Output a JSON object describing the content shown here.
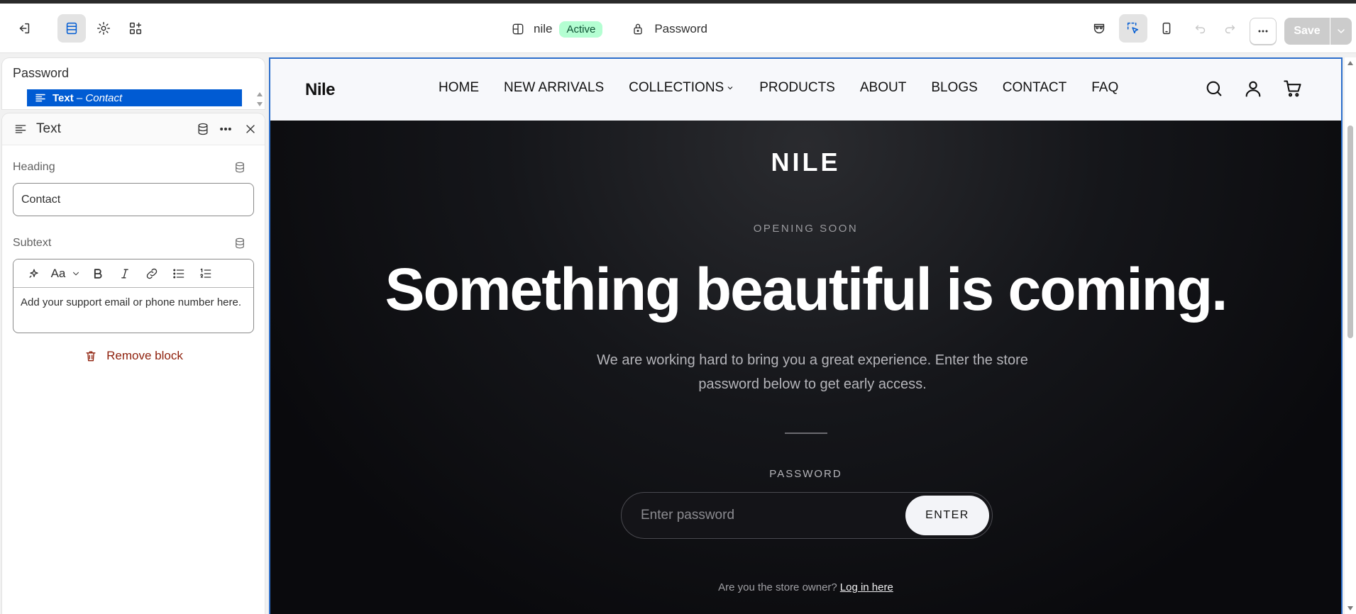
{
  "topbar": {
    "theme_name": "nile",
    "status_badge": "Active",
    "page_template": "Password",
    "save_label": "Save"
  },
  "sidebar": {
    "section_title": "Password",
    "tree_item_type": "Text",
    "tree_item_separator": " – ",
    "tree_item_name": "Contact",
    "block_title": "Text",
    "heading_label": "Heading",
    "heading_value": "Contact",
    "subtext_label": "Subtext",
    "subtext_value": "Add your support email or phone number here.",
    "remove_label": "Remove block"
  },
  "store": {
    "logo": "Nile",
    "nav": [
      "HOME",
      "NEW ARRIVALS",
      "COLLECTIONS",
      "PRODUCTS",
      "ABOUT",
      "BLOGS",
      "CONTACT",
      "FAQ"
    ],
    "brand": "NILE",
    "eyebrow": "OPENING SOON",
    "headline": "Something beautiful is coming.",
    "subcopy": "We are working hard to bring you a great experience. Enter the store password below to get early access.",
    "password_label": "PASSWORD",
    "password_placeholder": "Enter password",
    "enter_label": "ENTER",
    "owner_prompt": "Are you the store owner?",
    "owner_link": "Log in here"
  },
  "colors": {
    "accent": "#005bd3",
    "badge_bg": "#b4fed2",
    "danger": "#8e1f0b"
  }
}
